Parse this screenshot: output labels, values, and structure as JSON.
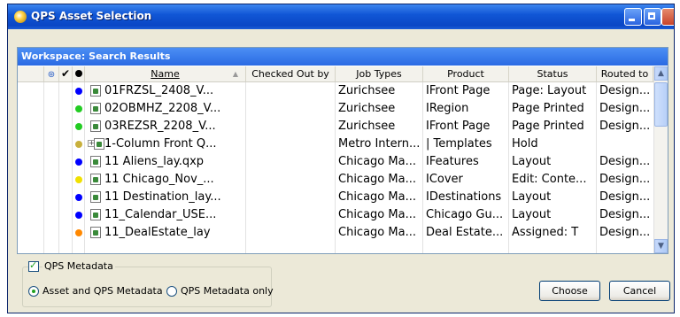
{
  "window": {
    "title": "QPS Asset Selection"
  },
  "panel": {
    "header": "Workspace: Search Results"
  },
  "columns": {
    "name": "Name",
    "checked_out_by": "Checked Out by",
    "job_types": "Job Types",
    "product": "Product",
    "status": "Status",
    "routed_to": "Routed to"
  },
  "rows": [
    {
      "name": "01FRZSL_2408_V...",
      "checked_out_by": "",
      "job_types": "Zurichsee",
      "product": "IFront Page",
      "status": "Page: Layout",
      "routed_to": "Design...",
      "dot_color": "#0000ff",
      "icon": "file-icon"
    },
    {
      "name": "02OBMHZ_2208_V...",
      "checked_out_by": "",
      "job_types": "Zurichsee",
      "product": "IRegion",
      "status": "Page Printed",
      "routed_to": "Design...",
      "dot_color": "#22cc22",
      "icon": "file-icon"
    },
    {
      "name": "03REZSR_2208_V...",
      "checked_out_by": "",
      "job_types": "Zurichsee",
      "product": "IFront Page",
      "status": "Page Printed",
      "routed_to": "Design...",
      "dot_color": "#22cc22",
      "icon": "file-icon"
    },
    {
      "name": "1-Column Front Q...",
      "checked_out_by": "",
      "job_types": "Metro Intern...",
      "product": "| Templates",
      "status": "Hold",
      "routed_to": "",
      "dot_color": "#c8b03c",
      "icon": "group-icon"
    },
    {
      "name": "11 Aliens_lay.qxp",
      "checked_out_by": "",
      "job_types": "Chicago Ma...",
      "product": "IFeatures",
      "status": "Layout",
      "routed_to": "Design...",
      "dot_color": "#0000ff",
      "icon": "file-icon"
    },
    {
      "name": "11 Chicago_Nov_...",
      "checked_out_by": "",
      "job_types": "Chicago Ma...",
      "product": "ICover",
      "status": "Edit: Conte...",
      "routed_to": "Design...",
      "dot_color": "#f0e000",
      "icon": "file-icon"
    },
    {
      "name": "11 Destination_lay...",
      "checked_out_by": "",
      "job_types": "Chicago Ma...",
      "product": "IDestinations",
      "status": "Layout",
      "routed_to": "Design...",
      "dot_color": "#0000ff",
      "icon": "file-icon"
    },
    {
      "name": "11_Calendar_USE...",
      "checked_out_by": "",
      "job_types": "Chicago Ma...",
      "product": "Chicago Gu...",
      "status": "Layout",
      "routed_to": "Design...",
      "dot_color": "#0000ff",
      "icon": "file-icon"
    },
    {
      "name": "11_DealEstate_lay",
      "checked_out_by": "",
      "job_types": "Chicago Ma...",
      "product": "Deal Estate...",
      "status": "Assigned: T",
      "routed_to": "Design...",
      "dot_color": "#ff8800",
      "icon": "file-icon"
    }
  ],
  "options": {
    "metadata_checkbox": "QPS Metadata",
    "radio_asset_and_qps": "Asset and QPS Metadata",
    "radio_qps_only": "QPS Metadata only"
  },
  "buttons": {
    "choose": "Choose",
    "cancel": "Cancel"
  }
}
